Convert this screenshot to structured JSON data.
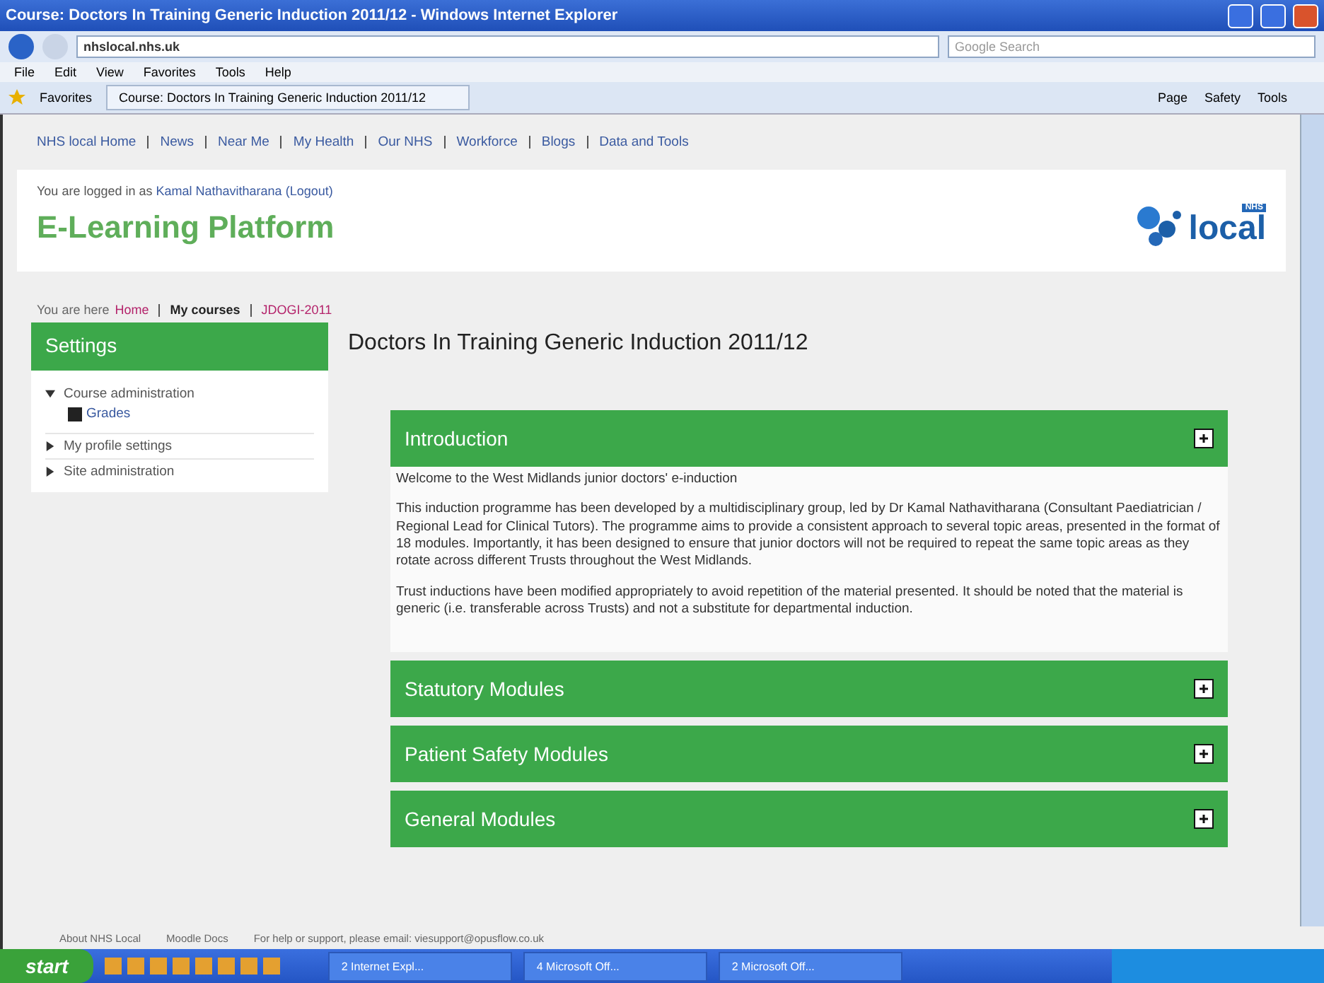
{
  "window": {
    "title": "Course: Doctors In Training Generic Induction 2011/12 - Windows Internet Explorer"
  },
  "address_bar": {
    "url": "nhslocal.nhs.uk",
    "search_placeholder": "Google Search"
  },
  "menu": [
    "File",
    "Edit",
    "View",
    "Favorites",
    "Tools",
    "Help"
  ],
  "favorites_bar": {
    "favorites": "Favorites",
    "tab": "Course: Doctors In Training Generic Induction 2011/12",
    "commands": [
      "Page",
      "Safety",
      "Tools"
    ]
  },
  "site_nav": [
    "NHS local Home",
    "News",
    "Near Me",
    "My Health",
    "Our NHS",
    "Workforce",
    "Blogs",
    "Data and Tools"
  ],
  "login": {
    "prefix": "You are logged in as",
    "user": "Kamal Nathavitharana",
    "logout": "(Logout)"
  },
  "site_title": "E-Learning Platform",
  "logo": {
    "badge": "NHS",
    "word": "local"
  },
  "breadcrumb": {
    "prefix": "You are here",
    "items": [
      {
        "label": "Home",
        "kind": "link"
      },
      {
        "label": "My courses",
        "kind": "bold"
      },
      {
        "label": "JDOGI-2011",
        "kind": "link"
      }
    ]
  },
  "settings": {
    "title": "Settings",
    "items": [
      {
        "label": "Course administration",
        "expanded": true,
        "children": [
          {
            "label": "Grades"
          }
        ]
      },
      {
        "label": "My profile settings",
        "expanded": false
      },
      {
        "label": "Site administration",
        "expanded": false
      }
    ]
  },
  "course_title": "Doctors In Training Generic Induction 2011/12",
  "sections": [
    {
      "title": "Introduction",
      "paragraphs": [
        "Welcome to the West Midlands junior doctors' e-induction",
        "This induction programme has been developed by a multidisciplinary group, led by Dr Kamal Nathavitharana (Consultant Paediatrician / Regional Lead for Clinical Tutors). The programme aims to provide a consistent approach to several topic areas, presented in the format of 18 modules. Importantly, it has been designed to ensure that junior doctors will not be required to repeat the same topic areas as they rotate across different Trusts throughout the West Midlands.",
        "Trust inductions have been modified appropriately to avoid repetition of the material presented. It should be noted that the material is generic (i.e. transferable across Trusts) and not a substitute for departmental induction."
      ]
    },
    {
      "title": "Statutory Modules"
    },
    {
      "title": "Patient Safety Modules"
    },
    {
      "title": "General Modules"
    }
  ],
  "footer": [
    "About NHS Local",
    "Moodle Docs",
    "For help or support, please email: viesupport@opusflow.co.uk"
  ],
  "taskbar": {
    "start": "start",
    "tasks": [
      "2 Internet Expl...",
      "4 Microsoft Off...",
      "2 Microsoft Off..."
    ]
  }
}
